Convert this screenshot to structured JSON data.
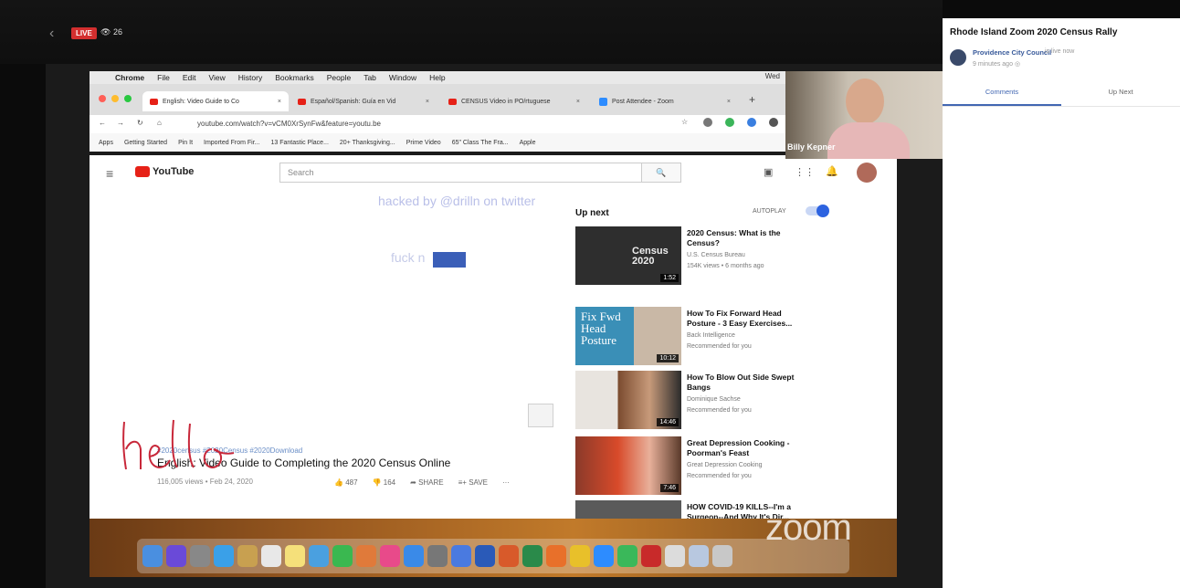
{
  "live": {
    "badge": "LIVE",
    "viewers": "26"
  },
  "mac_menu": {
    "items": [
      "Chrome",
      "File",
      "Edit",
      "View",
      "History",
      "Bookmarks",
      "People",
      "Tab",
      "Window",
      "Help"
    ],
    "clock": "Wed"
  },
  "browser": {
    "tabs": [
      {
        "label": "English: Video Guide to Co",
        "icon": "youtube-icon",
        "active": true
      },
      {
        "label": "Español/Spanish: Guía en Vid",
        "icon": "youtube-icon",
        "active": false
      },
      {
        "label": "CENSUS Video in PO/rtuguese",
        "icon": "youtube-icon",
        "active": false
      },
      {
        "label": "Post Attendee - Zoom",
        "icon": "zoom-icon",
        "active": false
      }
    ],
    "url": "youtube.com/watch?v=vCM0XrSynFw&feature=youtu.be",
    "bookmarks": [
      "Apps",
      "Getting Started",
      "Pin It",
      "Imported From Fir...",
      "13 Fantastic Place...",
      "20+ Thanksgiving...",
      "Prime Video",
      "65\" Class The Fra...",
      "Apple"
    ]
  },
  "youtube": {
    "logo": "YouTube",
    "search_placeholder": "Search",
    "overlay_text_1": "hacked by @drilln on twitter",
    "overlay_text_2": "fuck n",
    "overlay_text_2_end": "s",
    "hashtags": "#2020census #2020Census #2020Download",
    "title": "English: Video Guide to Completing the 2020 Census Online",
    "meta": "116,005 views • Feb 24, 2020",
    "likes": "487",
    "dislikes": "164",
    "share": "SHARE",
    "save": "SAVE",
    "up_next": "Up next",
    "autoplay": "AUTOPLAY",
    "recommendations": [
      {
        "title": "2020 Census: What is the Census?",
        "channel": "U.S. Census Bureau",
        "meta": "154K views • 6 months ago",
        "duration": "1:52",
        "thumb_text": "Census 2020"
      },
      {
        "title": "How To Fix Forward Head Posture - 3 Easy Exercises...",
        "channel": "Back Intelligence",
        "meta": "Recommended for you",
        "duration": "10:12",
        "thumb_text": "Fix Fwd Head Posture"
      },
      {
        "title": "How To Blow Out Side Swept Bangs",
        "channel": "Dominique Sachse",
        "meta": "Recommended for you",
        "duration": "14:46",
        "thumb_text": ""
      },
      {
        "title": "Great Depression Cooking - Poorman's Feast",
        "channel": "Great Depression Cooking",
        "meta": "Recommended for you",
        "duration": "7:46",
        "thumb_text": ""
      },
      {
        "title": "HOW COVID-19 KILLS--I'm a Surgeon--And Why It's Dir...",
        "channel": "",
        "meta": "",
        "duration": "",
        "thumb_text": ""
      }
    ]
  },
  "zoom": {
    "participant_name": "Billy Kepner",
    "watermark": "zoom",
    "annotation": "hello"
  },
  "panel": {
    "title": "Rhode Island Zoom 2020 Census Rally",
    "host": "Providence City Council",
    "host_suffix": "is live now",
    "time": "9 minutes ago",
    "tabs": [
      "Comments",
      "Up Next"
    ]
  }
}
